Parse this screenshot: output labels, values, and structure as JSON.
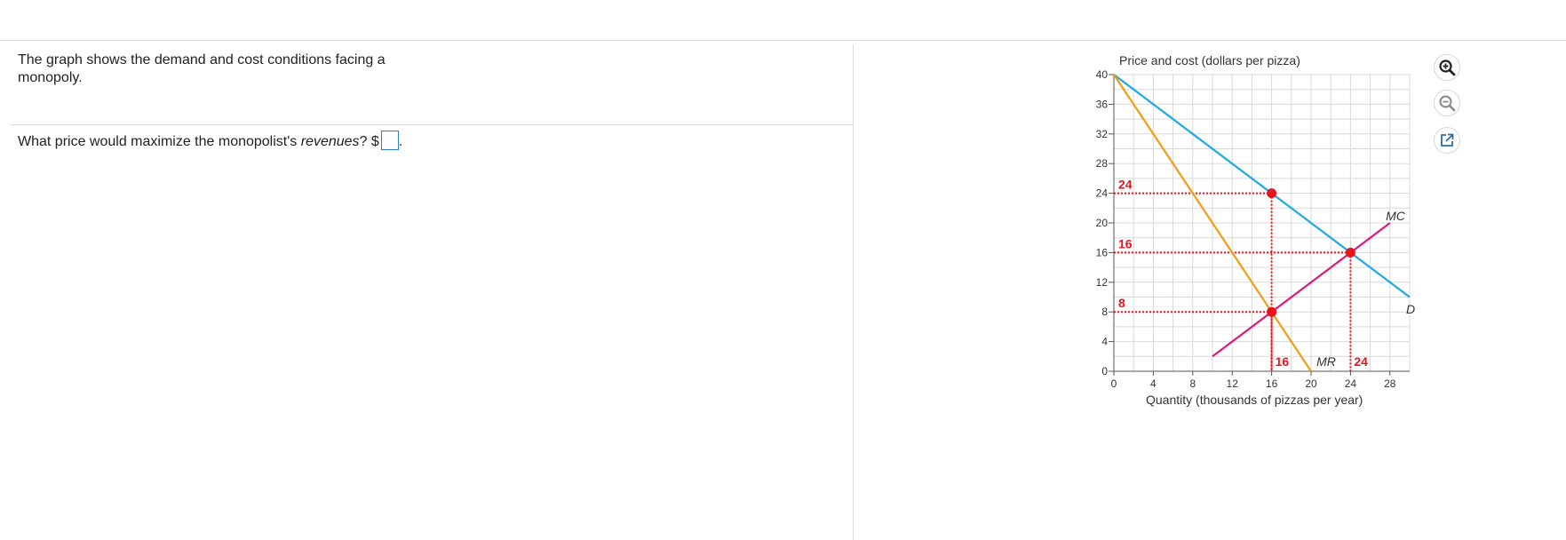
{
  "question": {
    "intro": "The graph shows the demand and cost conditions facing a monopoly.",
    "prompt_before": "What price would maximize the monopolist's ",
    "prompt_em": "revenues",
    "prompt_after": "? $",
    "answer_value": "",
    "period": "."
  },
  "toolbar": {
    "zoom_in_icon": "zoom-in-icon",
    "zoom_out_icon": "zoom-out-icon",
    "popout_icon": "external-link-icon"
  },
  "chart_data": {
    "type": "line",
    "ylabel": "Price and cost (dollars per pizza)",
    "xlabel": "Quantity (thousands of pizzas per year)",
    "xlim": [
      0,
      30
    ],
    "ylim": [
      0,
      40
    ],
    "xticks": [
      0,
      4,
      8,
      12,
      16,
      20,
      24,
      28
    ],
    "yticks": [
      0,
      4,
      8,
      12,
      16,
      20,
      24,
      28,
      32,
      36,
      40
    ],
    "grid": true,
    "series": [
      {
        "name": "D",
        "color": "#1ba8e8",
        "points": [
          [
            0,
            40
          ],
          [
            30,
            10
          ]
        ]
      },
      {
        "name": "MR",
        "color": "#f39c12",
        "points": [
          [
            0,
            40
          ],
          [
            20,
            0
          ]
        ]
      },
      {
        "name": "MC",
        "color": "#e0177a",
        "points": [
          [
            10,
            2
          ],
          [
            28,
            20
          ]
        ]
      }
    ],
    "markers": [
      {
        "x": 16,
        "y": 24
      },
      {
        "x": 24,
        "y": 16
      },
      {
        "x": 16,
        "y": 8
      }
    ],
    "guide_color": "#e8141b",
    "price_labels": [
      {
        "text": "24",
        "y": 24
      },
      {
        "text": "16",
        "y": 16
      },
      {
        "text": "8",
        "y": 8
      }
    ],
    "quantity_labels": [
      {
        "text": "16",
        "x": 16
      },
      {
        "text": "24",
        "x": 24
      }
    ]
  }
}
